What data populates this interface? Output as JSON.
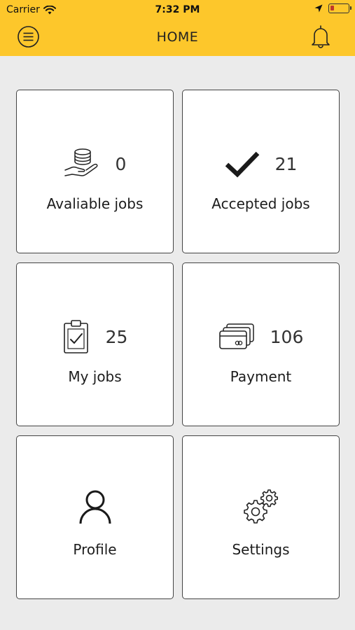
{
  "status_bar": {
    "carrier": "Carrier",
    "time": "7:32 PM",
    "icons": [
      "wifi-icon",
      "location-arrow-icon",
      "battery-icon"
    ]
  },
  "header": {
    "title": "HOME",
    "menu_icon": "hamburger-menu-icon",
    "notification_icon": "bell-icon",
    "background_color": "#fdc72b"
  },
  "tiles": [
    {
      "label": "Avaliable jobs",
      "count": "0",
      "icon": "coins-hand-icon"
    },
    {
      "label": "Accepted jobs",
      "count": "21",
      "icon": "checkmark-icon"
    },
    {
      "label": "My jobs",
      "count": "25",
      "icon": "clipboard-check-icon"
    },
    {
      "label": "Payment",
      "count": "106",
      "icon": "credit-cards-icon"
    },
    {
      "label": "Profile",
      "icon": "user-icon"
    },
    {
      "label": "Settings",
      "icon": "gears-icon"
    }
  ]
}
